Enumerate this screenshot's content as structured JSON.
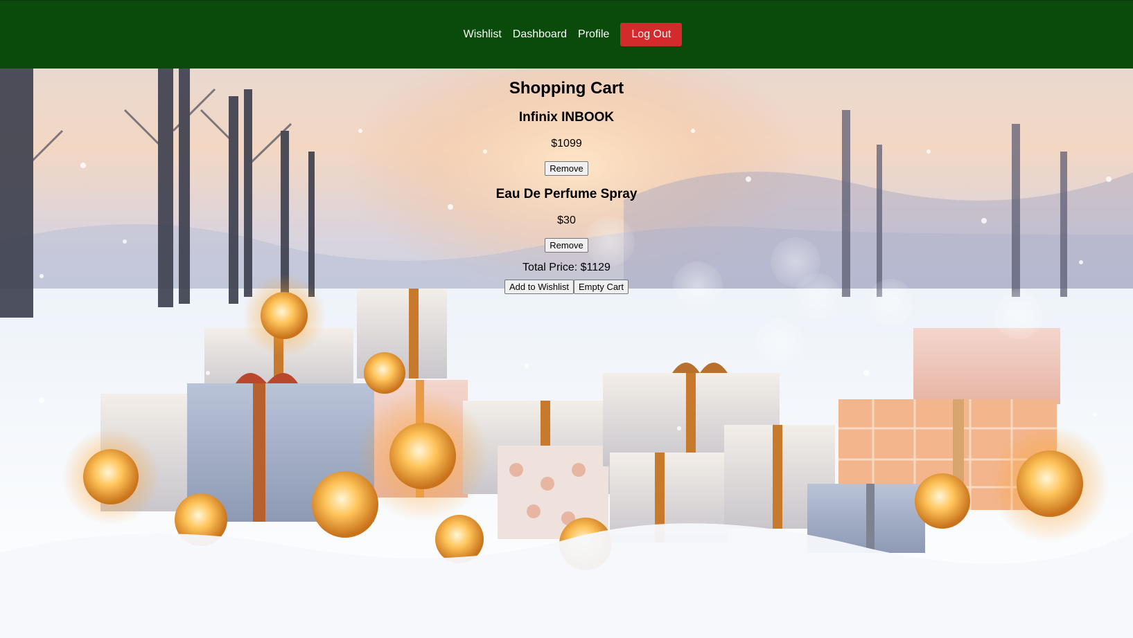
{
  "nav": {
    "links": [
      "Wishlist",
      "Dashboard",
      "Profile"
    ],
    "logout_label": "Log Out",
    "bar_color": "#0a4a0a",
    "logout_color": "#d32b2b"
  },
  "cart": {
    "title": "Shopping Cart",
    "items": [
      {
        "name": "Infinix INBOOK",
        "price": "$1099",
        "remove_label": "Remove"
      },
      {
        "name": "Eau De Perfume Spray",
        "price": "$30",
        "remove_label": "Remove"
      }
    ],
    "total": "Total Price: $1129",
    "add_to_wishlist_label": "Add to Wishlist",
    "empty_cart_label": "Empty Cart"
  },
  "background": {
    "description_icon": "winter-gifts-background"
  }
}
